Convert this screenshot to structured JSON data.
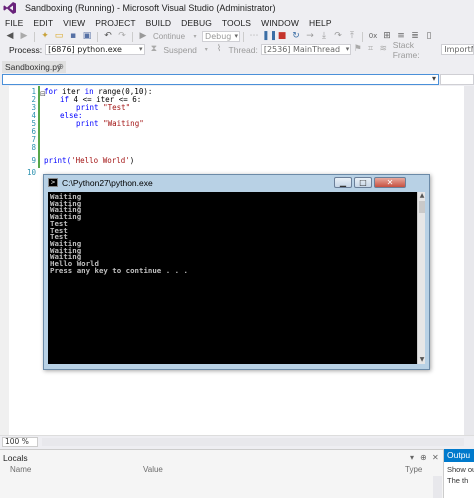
{
  "window": {
    "title": "Sandboxing (Running) - Microsoft Visual Studio (Administrator)",
    "logo": "VS"
  },
  "menu": [
    "FILE",
    "EDIT",
    "VIEW",
    "PROJECT",
    "BUILD",
    "DEBUG",
    "TOOLS",
    "WINDOW",
    "HELP"
  ],
  "toolbar": {
    "continue_label": "Continue",
    "config_value": "Debug"
  },
  "debug_toolbar": {
    "process_label": "Process:",
    "process_value": "[6876] python.exe",
    "suspend_label": "Suspend",
    "thread_label": "Thread:",
    "thread_value": "[2536] MainThread",
    "stack_frame_label": "Stack Frame:",
    "stack_frame_value": "ImportMes"
  },
  "document_tab": {
    "label": "Sandboxing.py",
    "pin": "⊕"
  },
  "editor": {
    "lines": [
      {
        "no": "1",
        "text": ""
      },
      {
        "no": "2",
        "text": ""
      },
      {
        "no": "3",
        "text": ""
      },
      {
        "no": "4",
        "text": ""
      },
      {
        "no": "5",
        "text": ""
      },
      {
        "no": "6",
        "text": ""
      },
      {
        "no": "7",
        "text": ""
      },
      {
        "no": "8",
        "text": ""
      },
      {
        "no": "9",
        "text": ""
      },
      {
        "no": "10",
        "text": ""
      }
    ],
    "code": {
      "l1_kw1": "for",
      "l1_rest": " iter ",
      "l1_kw2": "in",
      "l1_tail": " range(0,10):",
      "l2_kw": "if",
      "l2_tail": " 4 <= iter <= 6:",
      "l3_kw": "print",
      "l3_str": "\"Test\"",
      "l4_kw": "else:",
      "l5_kw": "print",
      "l5_str": "\"Waiting\"",
      "l9_fn": "print(",
      "l9_str": "'Hello World'",
      "l9_end": ")"
    }
  },
  "console": {
    "title": "C:\\Python27\\python.exe",
    "output": "Waiting\nWaiting\nWaiting\nWaiting\nTest\nTest\nTest\nWaiting\nWaiting\nWaiting\nHello World\nPress any key to continue . . .",
    "btn_min": "▁",
    "btn_max": "□",
    "btn_close": "✕"
  },
  "zoom": {
    "value": "100 %"
  },
  "locals": {
    "title": "Locals",
    "columns": [
      "Name",
      "Value",
      "Type"
    ]
  },
  "output_panel": {
    "tab": "Outpu",
    "lines": [
      "Show ou",
      "The th"
    ]
  }
}
